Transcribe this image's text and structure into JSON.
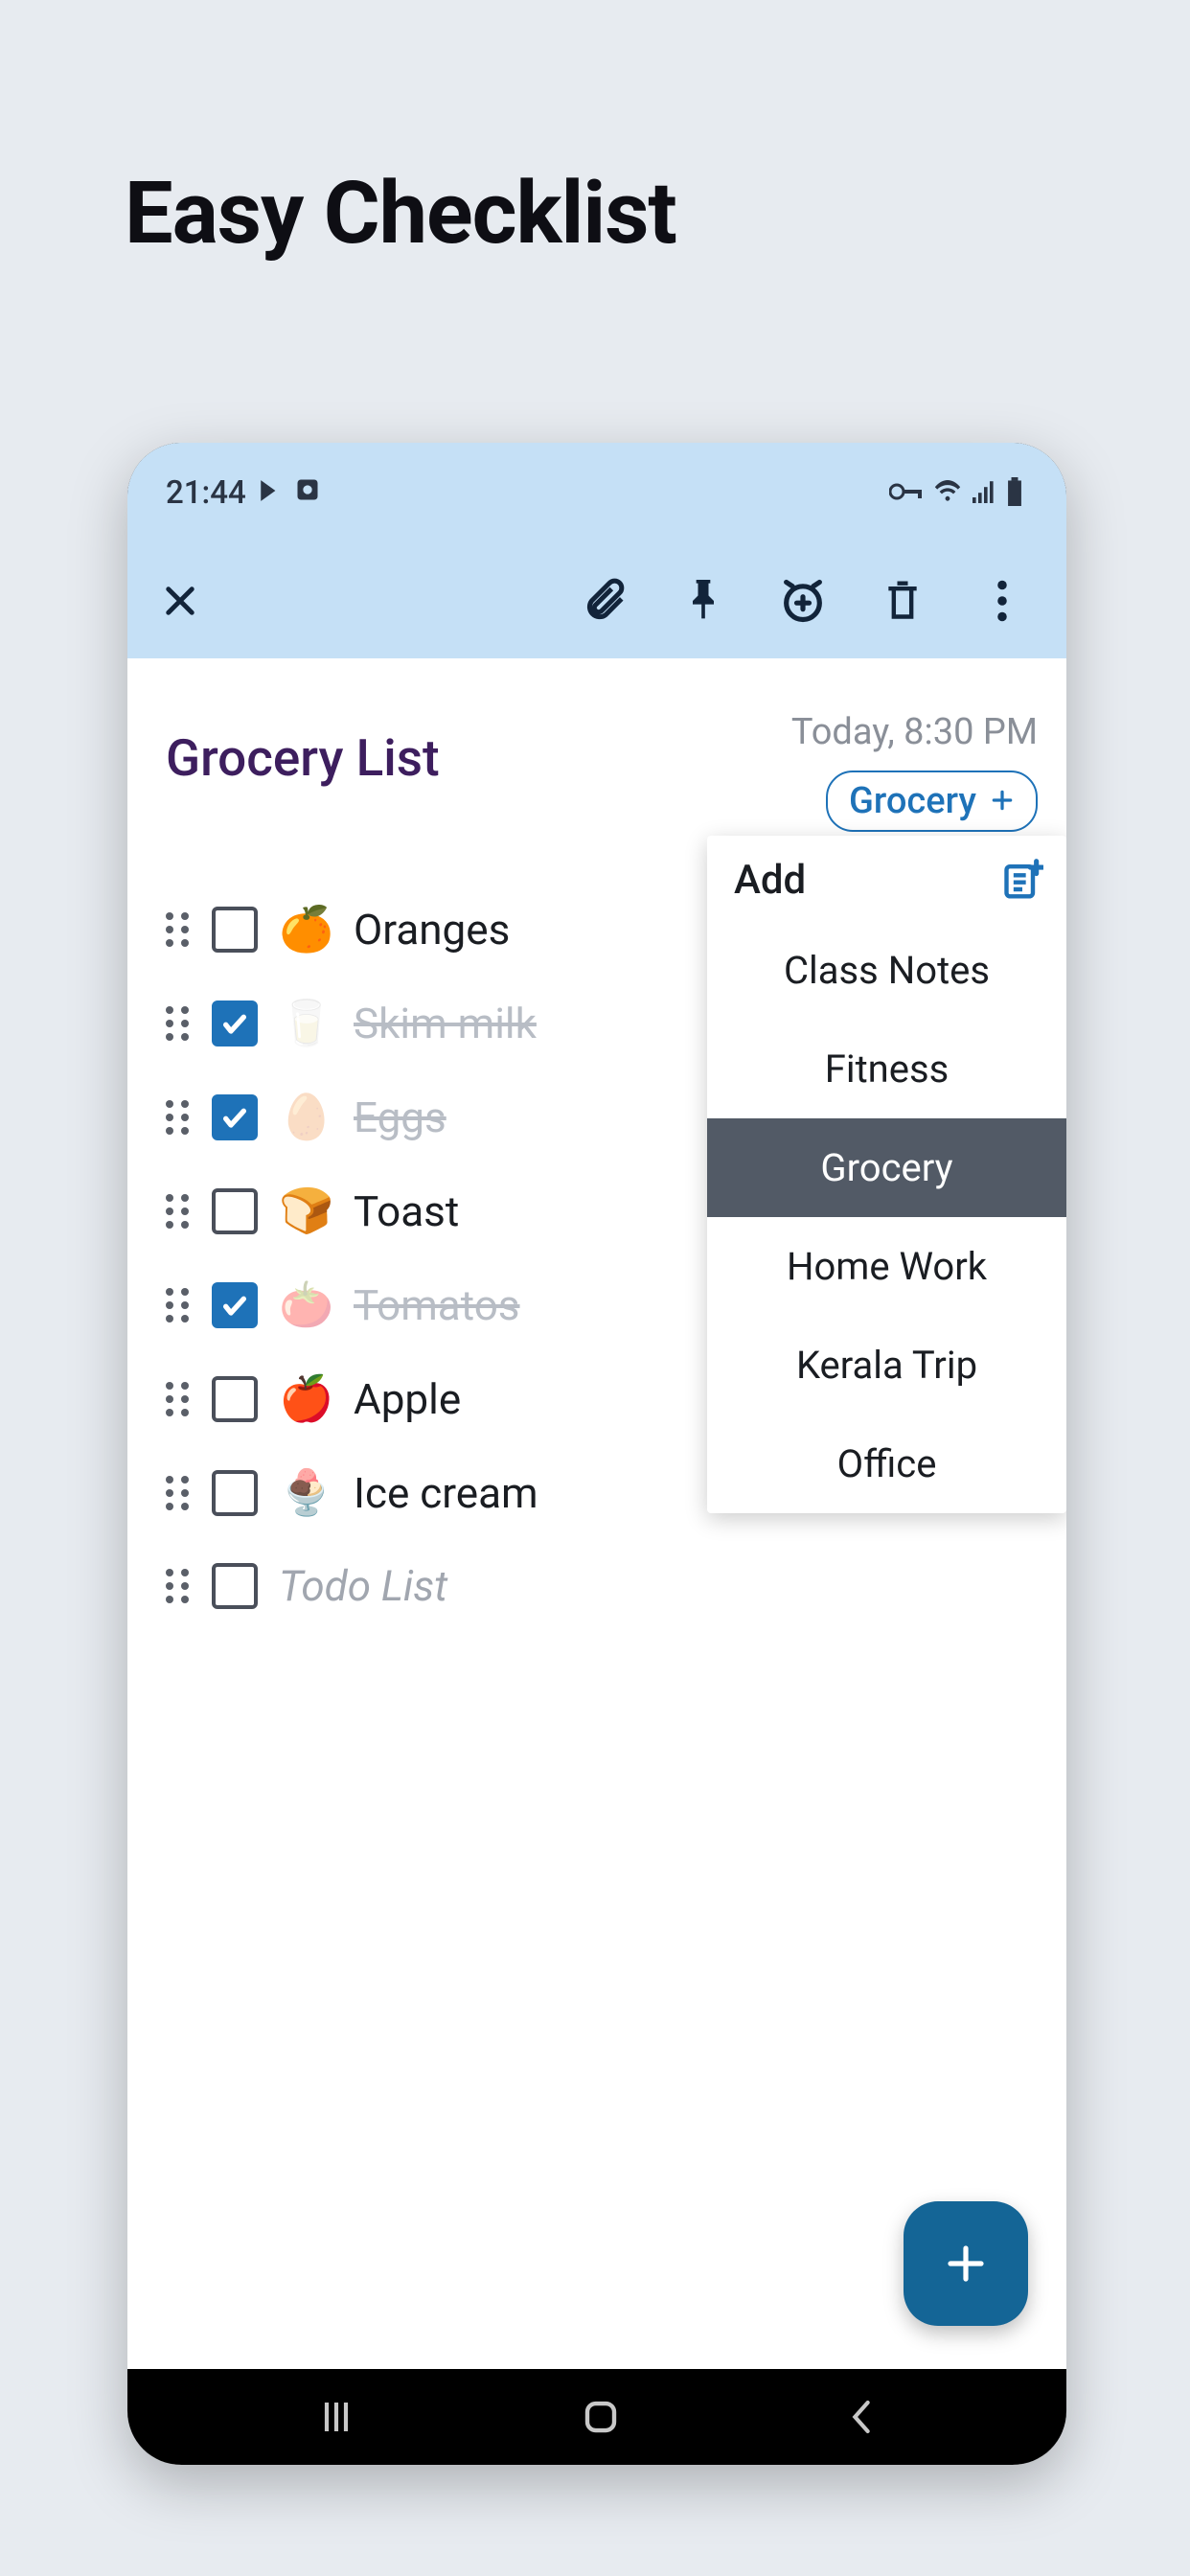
{
  "hero": {
    "title": "Easy Checklist"
  },
  "statusBar": {
    "time": "21:44"
  },
  "list": {
    "title": "Grocery List",
    "date": "Today, 8:30 PM",
    "tag": "Grocery",
    "placeholder": "Todo List",
    "items": [
      {
        "emoji": "🍊",
        "label": "Oranges",
        "checked": false
      },
      {
        "emoji": "🥛",
        "label": "Skim milk",
        "checked": true
      },
      {
        "emoji": "🥚",
        "label": "Eggs",
        "checked": true
      },
      {
        "emoji": "🍞",
        "label": "Toast",
        "checked": false
      },
      {
        "emoji": "🍅",
        "label": "Tomatos",
        "checked": true
      },
      {
        "emoji": "🍎",
        "label": "Apple",
        "checked": false
      },
      {
        "emoji": "🍨",
        "label": "Ice cream",
        "checked": false
      }
    ]
  },
  "dropdown": {
    "title": "Add",
    "items": [
      {
        "label": "Class Notes",
        "selected": false
      },
      {
        "label": "Fitness",
        "selected": false
      },
      {
        "label": "Grocery",
        "selected": true
      },
      {
        "label": "Home Work",
        "selected": false
      },
      {
        "label": "Kerala Trip",
        "selected": false
      },
      {
        "label": "Office",
        "selected": false
      }
    ]
  },
  "colors": {
    "accent": "#1e72b8",
    "titlePurple": "#3d1e5e",
    "headerBlue": "#c5e0f6",
    "fab": "#146596"
  }
}
